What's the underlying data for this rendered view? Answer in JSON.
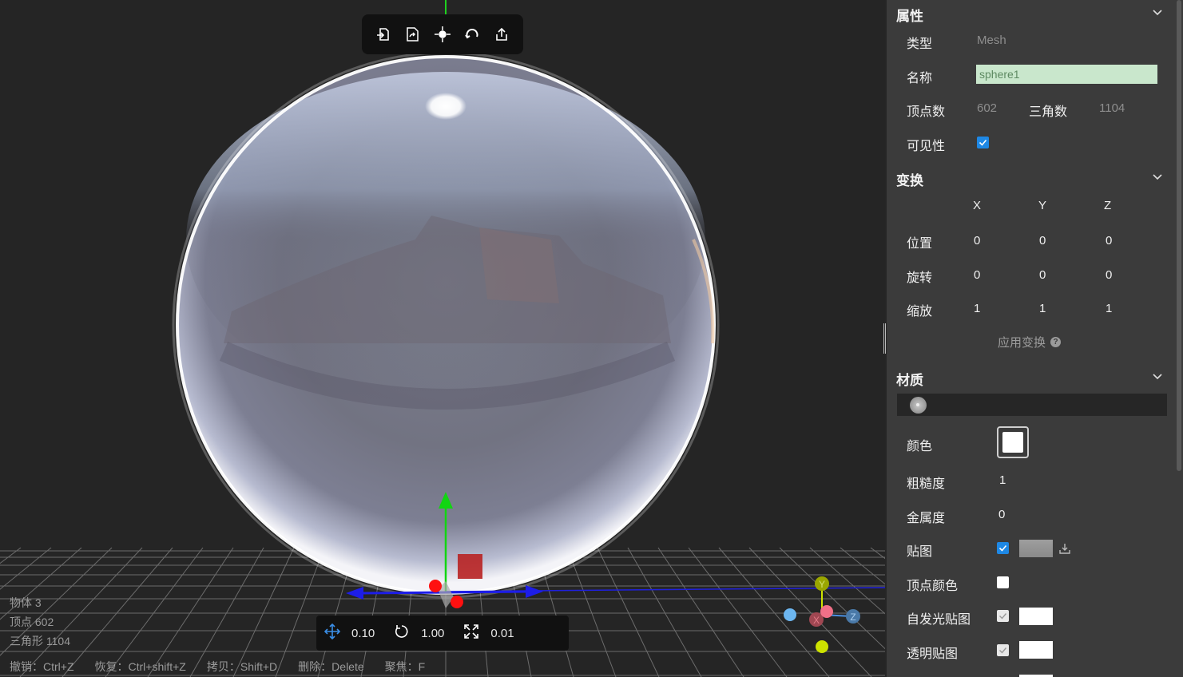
{
  "toolbar": {
    "icons": [
      "import-icon",
      "replace-icon",
      "focus-center-icon",
      "reset-icon",
      "export-icon"
    ]
  },
  "stats": {
    "objects": "物体 3",
    "vertices": "顶点 602",
    "triangles": "三角形 1104"
  },
  "shortcuts": [
    "撤销：Ctrl+Z",
    "恢复：Ctrl+shift+Z",
    "拷贝：Shift+D",
    "删除：Delete",
    "聚焦：F"
  ],
  "snap": {
    "translate": "0.10",
    "rotate": "1.00",
    "scale": "0.01"
  },
  "properties": {
    "title": "属性",
    "type_label": "类型",
    "type_value": "Mesh",
    "name_label": "名称",
    "name_value": "sphere1",
    "vertex_label": "顶点数",
    "vertex_value": "602",
    "triangle_label": "三角数",
    "triangle_value": "1104",
    "visible_label": "可见性",
    "visible": true
  },
  "transform": {
    "title": "变换",
    "axes": [
      "X",
      "Y",
      "Z"
    ],
    "rows": [
      {
        "label": "位置",
        "values": [
          "0",
          "0",
          "0"
        ]
      },
      {
        "label": "旋转",
        "values": [
          "0",
          "0",
          "0"
        ]
      },
      {
        "label": "缩放",
        "values": [
          "1",
          "1",
          "1"
        ]
      }
    ],
    "apply_label": "应用变换"
  },
  "material": {
    "title": "材质",
    "color_label": "颜色",
    "color_value": "#ffffff",
    "roughness_label": "粗糙度",
    "roughness_value": "1",
    "metalness_label": "金属度",
    "metalness_value": "0",
    "map_label": "贴图",
    "map_enabled": true,
    "vertex_color_label": "顶点颜色",
    "vertex_color_enabled": false,
    "emissive_map_label": "自发光贴图",
    "alpha_map_label": "透明贴图"
  },
  "gizmo_axes": {
    "x": "X",
    "y": "Y",
    "z": "Z"
  },
  "colors": {
    "panel_bg": "#3b3b3b",
    "viewport_bg": "#252525",
    "accent": "#1e88e5",
    "name_field_bg": "#c9e7cc"
  }
}
